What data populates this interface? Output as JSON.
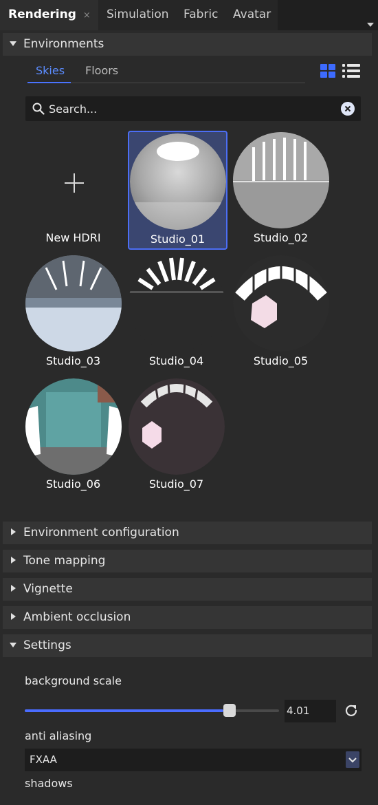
{
  "tabs": [
    {
      "label": "Rendering",
      "active": true,
      "close": "×"
    },
    {
      "label": "Simulation"
    },
    {
      "label": "Fabric"
    },
    {
      "label": "Avatar"
    }
  ],
  "environments": {
    "title": "Environments",
    "subtabs": [
      "Skies",
      "Floors"
    ],
    "active_subtab": "Skies",
    "search_placeholder": "Search...",
    "items": [
      {
        "label": "New HDRI",
        "type": "add"
      },
      {
        "label": "Studio_01",
        "selected": true
      },
      {
        "label": "Studio_02"
      },
      {
        "label": "Studio_03"
      },
      {
        "label": "Studio_04"
      },
      {
        "label": "Studio_05"
      },
      {
        "label": "Studio_06"
      },
      {
        "label": "Studio_07"
      }
    ]
  },
  "sections": [
    {
      "label": "Environment configuration",
      "expanded": false
    },
    {
      "label": "Tone mapping",
      "expanded": false
    },
    {
      "label": "Vignette",
      "expanded": false
    },
    {
      "label": "Ambient occlusion",
      "expanded": false
    },
    {
      "label": "Settings",
      "expanded": true
    }
  ],
  "settings": {
    "background_scale_label": "background scale",
    "background_scale_value": "4.01",
    "background_scale_fraction": 0.78,
    "anti_aliasing_label": "anti aliasing",
    "anti_aliasing_value": "FXAA",
    "shadows_label": "shadows"
  },
  "colors": {
    "accent": "#4a6cff",
    "panel": "#2a2a2a",
    "header": "#353535"
  }
}
